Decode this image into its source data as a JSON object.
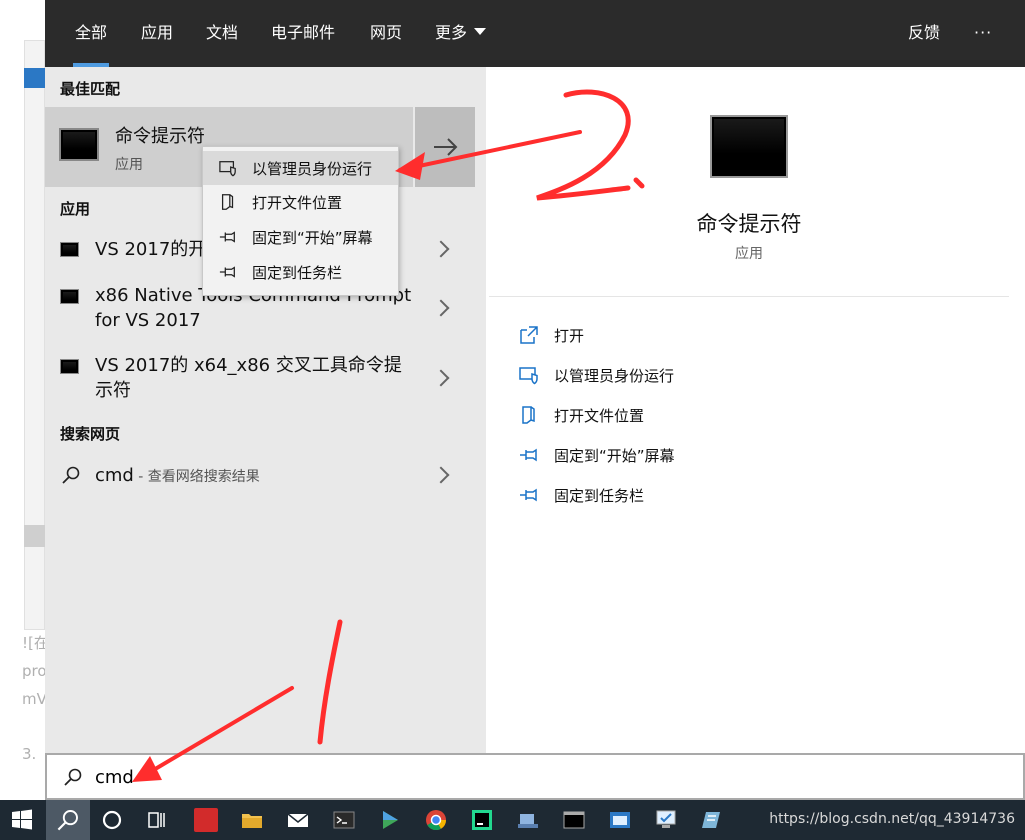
{
  "tabs": [
    {
      "label": "全部"
    },
    {
      "label": "应用"
    },
    {
      "label": "文档"
    },
    {
      "label": "电子邮件"
    },
    {
      "label": "网页"
    },
    {
      "label": "更多"
    }
  ],
  "feedback_label": "反馈",
  "more_options_label": "···",
  "best_match": {
    "header": "最佳匹配",
    "title": "命令提示符",
    "subtitle": "应用"
  },
  "apps": {
    "header": "应用",
    "items": [
      {
        "title": "VS 2017的开发人员命令提示符"
      },
      {
        "title": "x86 Native Tools Command Prompt for VS 2017"
      },
      {
        "title": "VS 2017的 x64_x86 交叉工具命令提示符"
      }
    ]
  },
  "web": {
    "header": "搜索网页",
    "query": "cmd",
    "hint": " - 查看网络搜索结果"
  },
  "context_menu": {
    "items": [
      {
        "label": "以管理员身份运行"
      },
      {
        "label": "打开文件位置"
      },
      {
        "label": "固定到“开始”屏幕"
      },
      {
        "label": "固定到任务栏"
      }
    ]
  },
  "preview": {
    "title": "命令提示符",
    "subtitle": "应用",
    "actions": [
      {
        "label": "打开"
      },
      {
        "label": "以管理员身份运行"
      },
      {
        "label": "打开文件位置"
      },
      {
        "label": "固定到“开始”屏幕"
      },
      {
        "label": "固定到任务栏"
      }
    ]
  },
  "search": {
    "value": "cmd"
  },
  "taskbar": {
    "url": "https://blog.csdn.net/qq_43914736"
  },
  "background_page": {
    "lines": [
      "![在",
      "pro",
      "mV",
      "3. "
    ]
  },
  "colors": {
    "accent": "#4f9be0",
    "annotation": "#ff2d2d",
    "topbar": "#2b2b2b",
    "taskbar": "#1e2933"
  }
}
